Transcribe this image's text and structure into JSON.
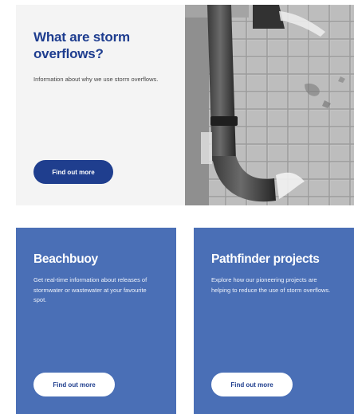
{
  "hero": {
    "title": "What are storm overflows?",
    "description": "Information about why we use storm overflows.",
    "button_label": "Find out more",
    "image_alt": "Drainpipe discharging water onto paving"
  },
  "cards": [
    {
      "title": "Beachbuoy",
      "description": "Get real-time information about releases of stormwater or wastewater at your favourite spot.",
      "button_label": "Find out more"
    },
    {
      "title": "Pathfinder projects",
      "description": "Explore how our pioneering projects are helping to reduce the use of storm overflows.",
      "button_label": "Find out more"
    }
  ],
  "colors": {
    "primary_dark": "#1f3e8e",
    "card_blue": "#4a6fb6",
    "hero_bg": "#f4f4f4"
  }
}
